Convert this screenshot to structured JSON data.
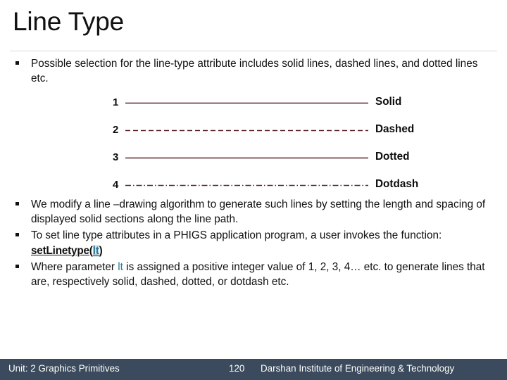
{
  "slide": {
    "title": "Line Type",
    "colors": {
      "line_sample": "#5a2328",
      "footer_bar": "#3b4b5d",
      "highlight_text": "#2e7a96",
      "highlight_bg": "#cfe7f1",
      "title_rule": "#d8d8d8"
    }
  },
  "bullets": {
    "intro": "Possible selection for the line-type attribute includes solid lines, dashed lines, and dotted lines etc.",
    "modify": "We modify a line –drawing algorithm to generate such lines by setting the length and spacing of displayed solid sections along the line path.",
    "phigs_prefix": "To set line type attributes in a PHIGS application program, a user invokes the function: ",
    "phigs_fn_open": "setLinetype(",
    "phigs_fn_param": "lt",
    "phigs_fn_close": ")",
    "where_prefix": "Where parameter ",
    "where_param": "lt",
    "where_suffix": " is assigned a positive integer value of 1, 2, 3, 4… etc. to generate lines that are, respectively solid, dashed, dotted, or dotdash etc."
  },
  "line_types": [
    {
      "number": "1",
      "label": "Solid",
      "pattern": "solid",
      "dasharray": ""
    },
    {
      "number": "2",
      "label": "Dashed",
      "pattern": "dashed",
      "dasharray": "7,4"
    },
    {
      "number": "3",
      "label": "Dotted",
      "pattern": "dotted",
      "dasharray": ""
    },
    {
      "number": "4",
      "label": "Dotdash",
      "pattern": "dotdash",
      "dasharray": "8,3,1.5,3"
    }
  ],
  "footer": {
    "unit": "Unit: 2 Graphics Primitives",
    "page": "120",
    "organization": "Darshan Institute of Engineering & Technology"
  }
}
